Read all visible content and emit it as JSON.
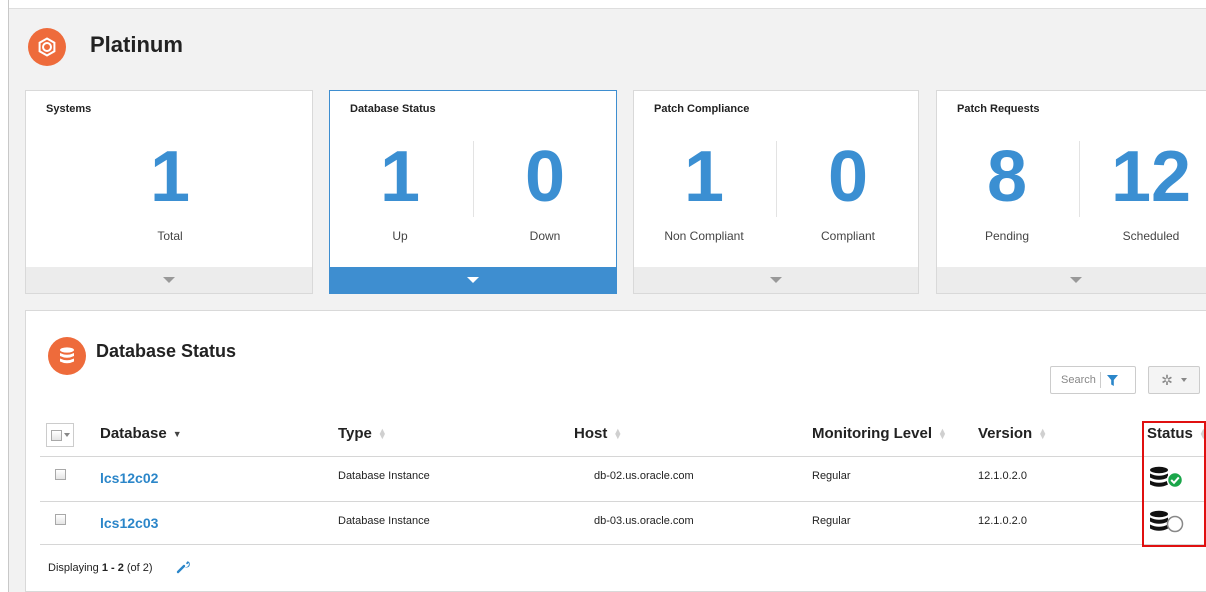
{
  "page": {
    "title": "Platinum",
    "icon": "gear-icon",
    "accent": "#ee6b3b",
    "blue": "#3b8fd2"
  },
  "cards": [
    {
      "title": "Systems",
      "metrics": [
        {
          "value": "1",
          "label": "Total"
        }
      ]
    },
    {
      "title": "Database Status",
      "selected": true,
      "metrics": [
        {
          "value": "1",
          "label": "Up"
        },
        {
          "value": "0",
          "label": "Down"
        }
      ]
    },
    {
      "title": "Patch Compliance",
      "metrics": [
        {
          "value": "1",
          "label": "Non Compliant"
        },
        {
          "value": "0",
          "label": "Compliant"
        }
      ]
    },
    {
      "title": "Patch Requests",
      "metrics": [
        {
          "value": "8",
          "label": "Pending"
        },
        {
          "value": "12",
          "label": "Scheduled"
        }
      ]
    }
  ],
  "panel": {
    "title": "Database Status",
    "icon": "database-icon",
    "search_placeholder": "Search",
    "columns": [
      "Database",
      "Type",
      "Host",
      "Monitoring Level",
      "Version",
      "Status"
    ],
    "rows": [
      {
        "database": "lcs12c02",
        "type": "Database Instance",
        "host": "db-02.us.oracle.com",
        "monitoring": "Regular",
        "version": "12.1.0.2.0",
        "status": "up"
      },
      {
        "database": "lcs12c03",
        "type": "Database Instance",
        "host": "db-03.us.oracle.com",
        "monitoring": "Regular",
        "version": "12.1.0.2.0",
        "status": "unknown"
      }
    ],
    "footer": {
      "prefix": "Displaying ",
      "range": "1 - 2",
      "suffix": " (of 2)"
    }
  }
}
